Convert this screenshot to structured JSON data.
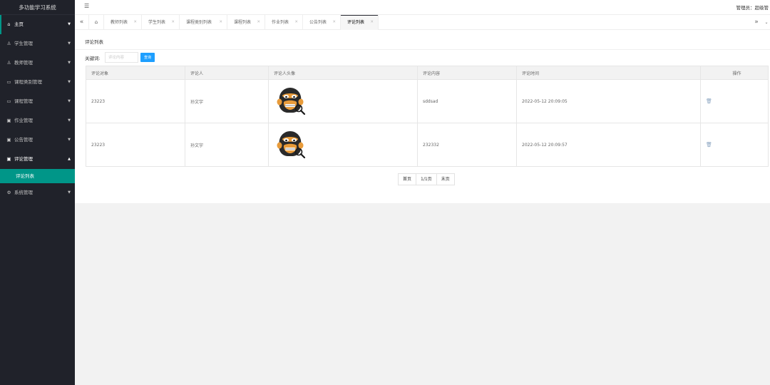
{
  "app": {
    "title": "多功能学习系统"
  },
  "sidebar": {
    "items": [
      {
        "label": "主页",
        "icon": "home-icon"
      },
      {
        "label": "学生管理",
        "icon": "user-icon"
      },
      {
        "label": "教师管理",
        "icon": "user-icon"
      },
      {
        "label": "课程类别管理",
        "icon": "folder-icon"
      },
      {
        "label": "课程管理",
        "icon": "folder-icon"
      },
      {
        "label": "作业管理",
        "icon": "calendar-icon"
      },
      {
        "label": "公告管理",
        "icon": "calendar-icon"
      },
      {
        "label": "评论管理",
        "icon": "calendar-icon"
      },
      {
        "label": "系统管理",
        "icon": "gear-icon"
      }
    ],
    "sub_item": "评论列表",
    "accent": "#009688",
    "bg": "#20222a"
  },
  "header": {
    "user": "管理员：超级管"
  },
  "tabs": [
    {
      "label": "教师列表"
    },
    {
      "label": "学生列表"
    },
    {
      "label": "课程类别列表"
    },
    {
      "label": "课程列表"
    },
    {
      "label": "作业列表"
    },
    {
      "label": "公告列表"
    },
    {
      "label": "评论列表"
    }
  ],
  "main": {
    "title": "评论列表",
    "search": {
      "label": "关键词:",
      "placeholder": "评论内容",
      "button": "查询"
    },
    "table": {
      "headers": [
        "评论对象",
        "评论人",
        "评论人头像",
        "评论内容",
        "评论时间",
        "操作"
      ],
      "rows": [
        {
          "target": "23223",
          "user": "孙文宇",
          "content": "sddsad",
          "time": "2022-05-12 20:09:05"
        },
        {
          "target": "23223",
          "user": "孙文宇",
          "content": "232332",
          "time": "2022-05-12 20:09:57"
        }
      ]
    },
    "pager": {
      "first": "首页",
      "pages": "1/1页",
      "last": "末页"
    }
  },
  "colors": {
    "primary_button": "#1e9fff"
  }
}
